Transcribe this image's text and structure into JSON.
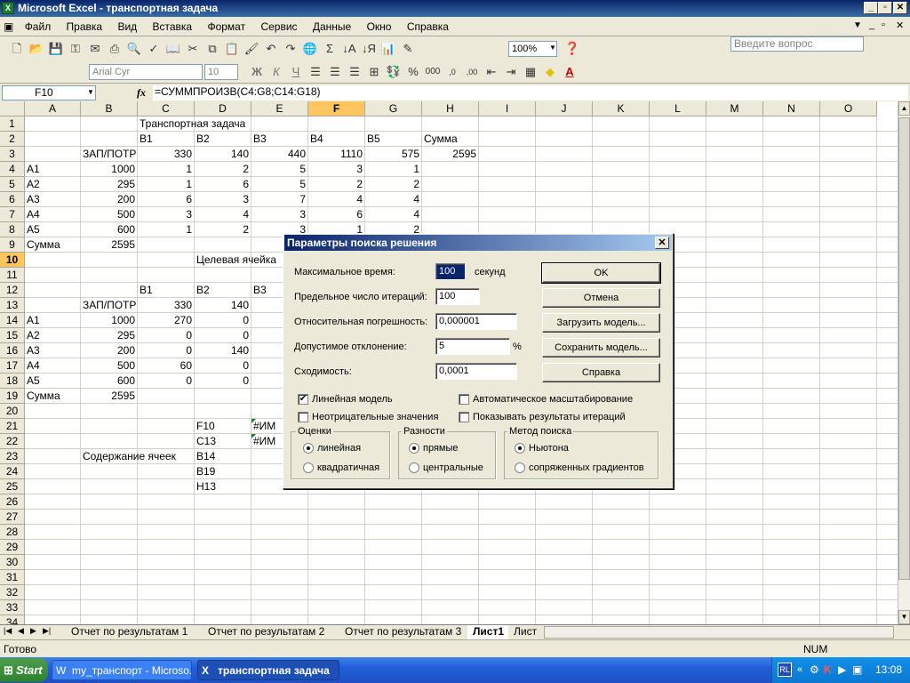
{
  "window": {
    "title": "Microsoft Excel - транспортная задача",
    "app_icon": "excel-icon"
  },
  "menu": {
    "items": [
      "Файл",
      "Правка",
      "Вид",
      "Вставка",
      "Формат",
      "Сервис",
      "Данные",
      "Окно",
      "Справка"
    ],
    "question_placeholder": "Введите вопрос"
  },
  "toolbar": {
    "zoom": "100%",
    "font_name": "Arial Cyr",
    "font_size": "10"
  },
  "formula_bar": {
    "cell_ref": "F10",
    "fx_label": "fx",
    "formula": "=СУММПРОИЗВ(C4:G8;C14:G18)"
  },
  "grid": {
    "columns": [
      "A",
      "B",
      "C",
      "D",
      "E",
      "F",
      "G",
      "H",
      "I",
      "J",
      "K",
      "L",
      "M",
      "N",
      "O"
    ],
    "rows": [
      "1",
      "2",
      "3",
      "4",
      "5",
      "6",
      "7",
      "8",
      "9",
      "10",
      "11",
      "12",
      "13",
      "14",
      "15",
      "16",
      "17",
      "18",
      "19",
      "20",
      "21",
      "22",
      "23",
      "24",
      "25",
      "26",
      "27",
      "28",
      "29",
      "30",
      "31",
      "32",
      "33",
      "34"
    ],
    "selected_column": "F",
    "selected_row": "10"
  },
  "cells": {
    "C1": "Транспортная задача",
    "C2": "B1",
    "D2": "B2",
    "E2": "B3",
    "F2": "B4",
    "G2": "B5",
    "H2": "Сумма",
    "B3": "ЗАП/ПОТР",
    "C3": "330",
    "D3": "140",
    "E3": "440",
    "F3": "1110",
    "G3": "575",
    "H3": "2595",
    "A4": "A1",
    "B4": "1000",
    "C4": "1",
    "D4": "2",
    "E4": "5",
    "F4": "3",
    "G4": "1",
    "A5": "A2",
    "B5": "295",
    "C5": "1",
    "D5": "6",
    "E5": "5",
    "F5": "2",
    "G5": "2",
    "A6": "A3",
    "B6": "200",
    "C6": "6",
    "D6": "3",
    "E6": "7",
    "F6": "4",
    "G6": "4",
    "A7": "A4",
    "B7": "500",
    "C7": "3",
    "D7": "4",
    "E7": "3",
    "F7": "6",
    "G7": "4",
    "A8": "A5",
    "B8": "600",
    "C8": "1",
    "D8": "2",
    "E8": "3",
    "F8": "1",
    "G8": "2",
    "A9": "Сумма",
    "B9": "2595",
    "D10": "Целевая ячейка",
    "C12": "B1",
    "D12": "B2",
    "E12": "B3",
    "B13": "ЗАП/ПОТР",
    "C13": "330",
    "D13": "140",
    "A14": "A1",
    "B14": "1000",
    "C14": "270",
    "D14": "0",
    "A15": "A2",
    "B15": "295",
    "C15": "0",
    "D15": "0",
    "A16": "A3",
    "B16": "200",
    "C16": "0",
    "D16": "140",
    "A17": "A4",
    "B17": "500",
    "C17": "60",
    "D17": "0",
    "A18": "A5",
    "B18": "600",
    "C18": "0",
    "D18": "0",
    "A19": "Сумма",
    "B19": "2595",
    "D21": "F10",
    "E21": "#ИМ",
    "D22": "C13",
    "E22": "#ИМ",
    "B23": "Содержание ячеек",
    "D23": "B14",
    "D24": "B19",
    "D25": "H13"
  },
  "sheet_tabs": {
    "tabs": [
      "Отчет по результатам 1",
      "Отчет по результатам 2",
      "Отчет по результатам 3",
      "Лист1",
      "Лист"
    ],
    "active": "Лист1"
  },
  "status": {
    "left": "Готово",
    "num": "NUM"
  },
  "taskbar": {
    "start_label": "Start",
    "tasks": [
      "my_транспорт - Microso...",
      "транспортная задача"
    ],
    "lang": "RL",
    "clock": "13:08"
  },
  "dialog": {
    "title": "Параметры поиска решения",
    "fields": [
      {
        "label": "Максимальное время:",
        "value": "100",
        "unit": "секунд"
      },
      {
        "label": "Предельное число итераций:",
        "value": "100",
        "unit": ""
      },
      {
        "label": "Относительная погрешность:",
        "value": "0,000001",
        "unit": ""
      },
      {
        "label": "Допустимое отклонение:",
        "value": "5",
        "unit": "%"
      },
      {
        "label": "Сходимость:",
        "value": "0,0001",
        "unit": ""
      }
    ],
    "buttons": [
      "OK",
      "Отмена",
      "Загрузить модель...",
      "Сохранить модель...",
      "Справка"
    ],
    "checkboxes": [
      {
        "label": "Линейная модель",
        "checked": true
      },
      {
        "label": "Автоматическое масштабирование",
        "checked": false
      },
      {
        "label": "Неотрицательные значения",
        "checked": false
      },
      {
        "label": "Показывать результаты итераций",
        "checked": false
      }
    ],
    "groups": [
      {
        "title": "Оценки",
        "options": [
          "линейная",
          "квадратичная"
        ],
        "selected": 0
      },
      {
        "title": "Разности",
        "options": [
          "прямые",
          "центральные"
        ],
        "selected": 0
      },
      {
        "title": "Метод поиска",
        "options": [
          "Ньютона",
          "сопряженных градиентов"
        ],
        "selected": 0
      }
    ]
  }
}
